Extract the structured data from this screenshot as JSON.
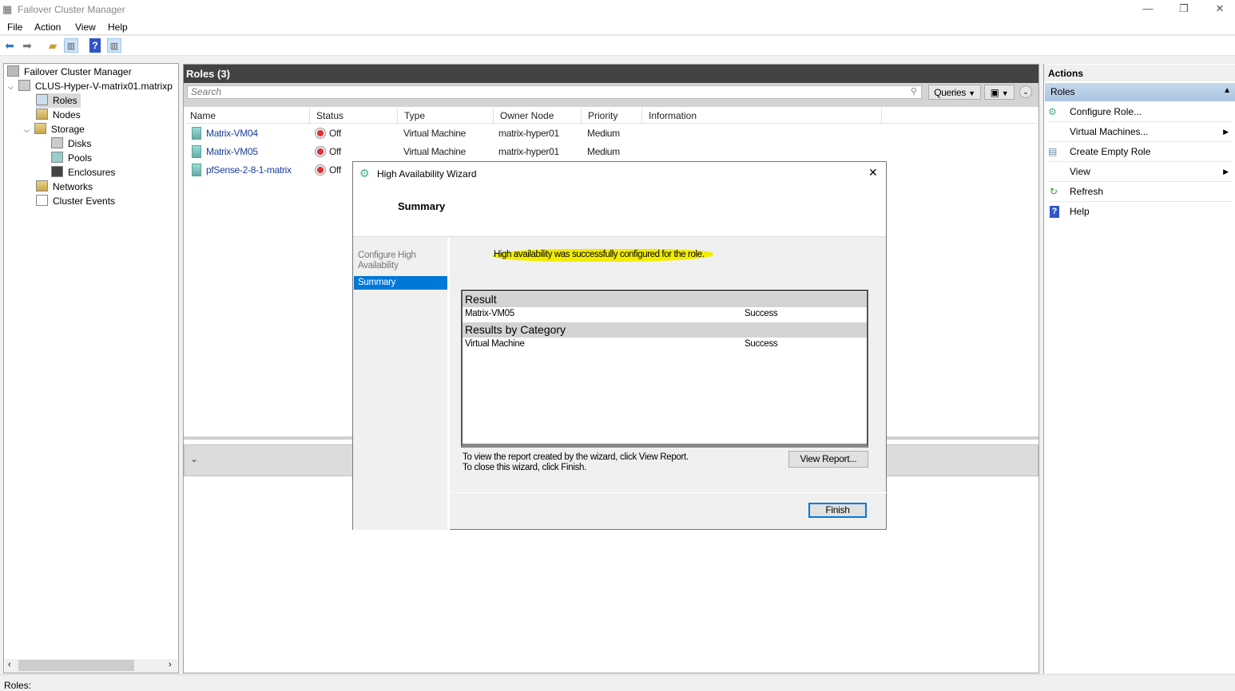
{
  "window": {
    "title": "Failover Cluster Manager",
    "minimize": "—",
    "restore": "❐",
    "close": "✕"
  },
  "menu": [
    "File",
    "Action",
    "View",
    "Help"
  ],
  "toolbar": {
    "icons": [
      "back-arrow-icon",
      "forward-arrow-icon",
      "up-folder-icon",
      "show-hide-console-tree-icon",
      "help-icon",
      "show-hide-action-pane-icon"
    ]
  },
  "tree": {
    "root": "Failover Cluster Manager",
    "cluster": "CLUS-Hyper-V-matrix01.matrixp",
    "items": [
      {
        "label": "Roles",
        "selected": true
      },
      {
        "label": "Nodes"
      },
      {
        "label": "Storage"
      },
      {
        "label": "Disks"
      },
      {
        "label": "Pools"
      },
      {
        "label": "Enclosures"
      },
      {
        "label": "Networks"
      },
      {
        "label": "Cluster Events"
      }
    ]
  },
  "roles": {
    "title": "Roles (3)",
    "search_placeholder": "Search",
    "queries": "Queries",
    "columns": [
      "Name",
      "Status",
      "Type",
      "Owner Node",
      "Priority",
      "Information"
    ],
    "rows": [
      {
        "name": "Matrix-VM04",
        "status": "Off",
        "type": "Virtual Machine",
        "owner": "matrix-hyper01",
        "priority": "Medium"
      },
      {
        "name": "Matrix-VM05",
        "status": "Off",
        "type": "Virtual Machine",
        "owner": "matrix-hyper01",
        "priority": "Medium"
      },
      {
        "name": "pfSense-2-8-1-matrix",
        "status": "Off",
        "type": "",
        "owner": "",
        "priority": ""
      }
    ]
  },
  "actions": {
    "title": "Actions",
    "section": "Roles",
    "items": [
      "Configure Role...",
      "Virtual Machines...",
      "Create Empty Role",
      "View",
      "Refresh",
      "Help"
    ]
  },
  "wizard": {
    "title": "High Availability Wizard",
    "heading": "Summary",
    "steps": [
      "Configure High Availability",
      "Summary"
    ],
    "message": "High availability was successfully configured for the role.",
    "result_header": "Result",
    "result_name": "Matrix-VM05",
    "result_status": "Success",
    "category_header": "Results by Category",
    "category_name": "Virtual Machine",
    "category_status": "Success",
    "hint1": "To view the report created by the wizard, click View Report.",
    "hint2": "To close this wizard, click Finish.",
    "view_report": "View Report...",
    "finish": "Finish",
    "highlight_color": "#f2ec00"
  },
  "status": "Roles:"
}
